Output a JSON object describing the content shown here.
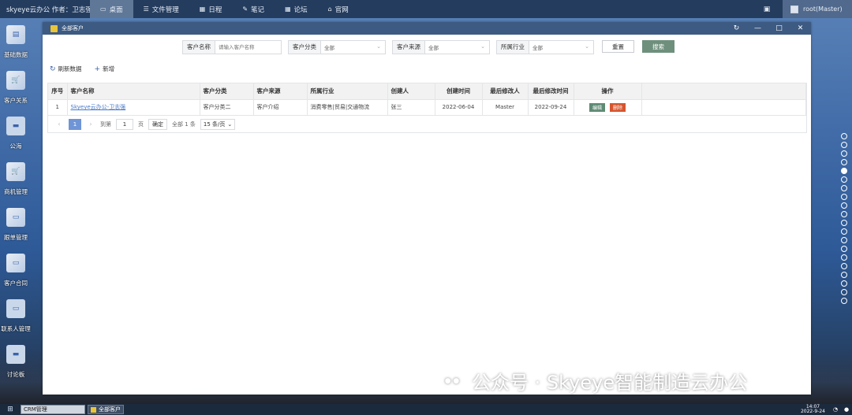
{
  "topbar": {
    "brand": "skyeye云办公 作者：卫志强",
    "nav": [
      {
        "icon": "monitor-icon",
        "glyph": "🖥",
        "label": "桌面"
      },
      {
        "icon": "list-icon",
        "glyph": "☰",
        "label": "文件管理"
      },
      {
        "icon": "calendar-icon",
        "glyph": "▦",
        "label": "日程"
      },
      {
        "icon": "note-icon",
        "glyph": "✎",
        "label": "笔记"
      },
      {
        "icon": "forum-icon",
        "glyph": "▦",
        "label": "论坛"
      },
      {
        "icon": "home-icon",
        "glyph": "⌂",
        "label": "官网"
      }
    ],
    "user": "root(Master)"
  },
  "desktop": [
    {
      "label": "基础数据"
    },
    {
      "label": "客户关系"
    },
    {
      "label": "公海"
    },
    {
      "label": "商机管理"
    },
    {
      "label": "跟单管理"
    },
    {
      "label": "客户合同"
    },
    {
      "label": "联系人管理"
    },
    {
      "label": "讨论板"
    }
  ],
  "window": {
    "title": "全部客户",
    "filters": {
      "name_label": "客户名称",
      "name_placeholder": "请输入客户名称",
      "category_label": "客户分类",
      "category_value": "全部",
      "source_label": "客户来源",
      "source_value": "全部",
      "industry_label": "所属行业",
      "industry_value": "全部",
      "reset": "重置",
      "search": "搜索"
    },
    "toolbar": {
      "refresh": "刷新数据",
      "add": "新增"
    },
    "table": {
      "headers": [
        "序号",
        "客户名称",
        "客户分类",
        "客户来源",
        "所属行业",
        "创建人",
        "创建时间",
        "最后修改人",
        "最后修改时间",
        "操作"
      ],
      "rows": [
        {
          "index": "1",
          "name": "Skyeye云办公-卫志强",
          "category": "客户分类二",
          "source": "客户介绍",
          "industry": "消费零售|贸易|交通物流",
          "creator": "张三",
          "created": "2022-06-04",
          "modifier": "Master",
          "modified": "2022-09-24",
          "edit": "编辑",
          "delete": "删除"
        }
      ]
    },
    "pager": {
      "current": "1",
      "goto_label": "到第",
      "page_input": "1",
      "page_unit": "页",
      "confirm": "确定",
      "total": "全部 1 条",
      "page_size": "15 条/页"
    }
  },
  "watermark": "公众号 · Skyeye智能制造云办公",
  "taskbar": {
    "task1": "CRM管理",
    "task2": "全部客户",
    "time": "14:07",
    "date": "2022-9-24"
  }
}
